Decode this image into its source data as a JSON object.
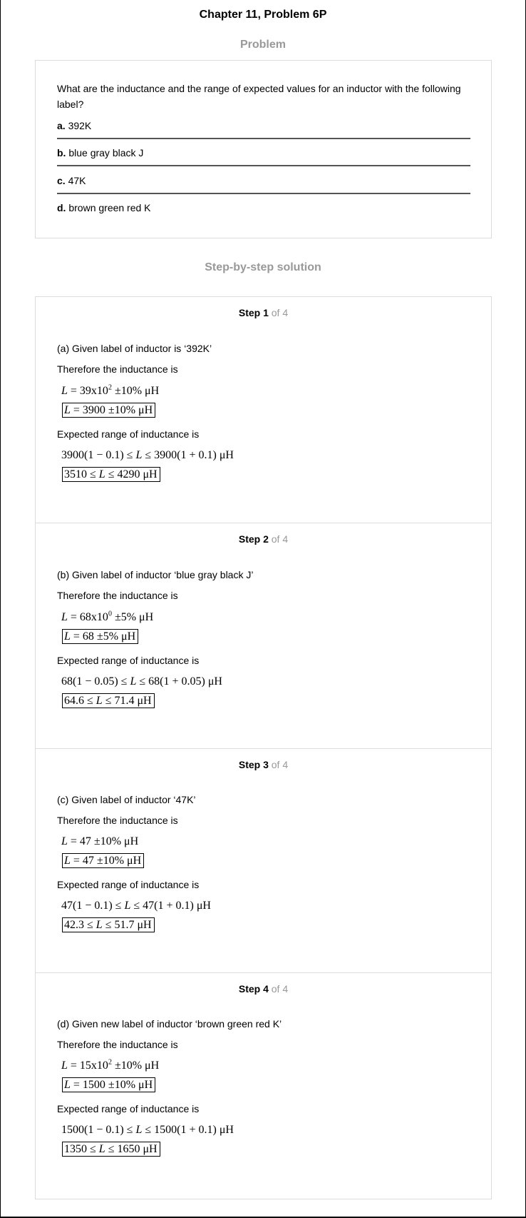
{
  "page": {
    "title": "Chapter 11, Problem 6P",
    "problem_heading": "Problem",
    "solution_heading": "Step-by-step solution"
  },
  "problem": {
    "question": "What are the inductance and the range of expected values for an inductor with the following label?",
    "parts": [
      {
        "letter": "a.",
        "text": "392K"
      },
      {
        "letter": "b.",
        "text": "blue gray black J"
      },
      {
        "letter": "c.",
        "text": "47K"
      },
      {
        "letter": "d.",
        "text": "brown green red K"
      }
    ]
  },
  "steps": [
    {
      "label": "Step 1",
      "of": "of 4",
      "given": "(a) Given label of inductor is ‘392K’",
      "therefore": "Therefore the inductance is",
      "expected": "Expected range of inductance is",
      "eq1": {
        "lhs": "L",
        "rhs_pre": " = 39x10",
        "exp": "2",
        "rhs_post": " ±10% μH"
      },
      "eq2": {
        "lhs": "L",
        "rhs": " = 3900 ±10% μH"
      },
      "range1": {
        "pre": "3900(1 − 0.1) ≤ ",
        "var": "L",
        "post": " ≤ 3900(1 + 0.1) μH"
      },
      "range2": {
        "pre": "3510 ≤ ",
        "var": "L",
        "post": " ≤ 4290 μH"
      }
    },
    {
      "label": "Step 2",
      "of": "of 4",
      "given": "(b) Given label of inductor ‘blue gray black J’",
      "therefore": "Therefore the inductance is",
      "expected": "Expected range of inductance is",
      "eq1": {
        "lhs": "L",
        "rhs_pre": " = 68x10",
        "exp": "0",
        "rhs_post": " ±5% μH"
      },
      "eq2": {
        "lhs": "L",
        "rhs": " = 68 ±5% μH"
      },
      "range1": {
        "pre": "68(1 − 0.05) ≤ ",
        "var": "L",
        "post": " ≤ 68(1 + 0.05) μH"
      },
      "range2": {
        "pre": "64.6 ≤ ",
        "var": "L",
        "post": " ≤ 71.4 μH"
      }
    },
    {
      "label": "Step 3",
      "of": "of 4",
      "given": "(c) Given label of inductor ‘47K’",
      "therefore": "Therefore the inductance is",
      "expected": "Expected range of inductance is",
      "eq1": {
        "lhs": "L",
        "rhs_pre": " = 47 ±10% μH",
        "exp": "",
        "rhs_post": ""
      },
      "eq2": {
        "lhs": "L",
        "rhs": " = 47 ±10% μH"
      },
      "range1": {
        "pre": "47(1 − 0.1) ≤ ",
        "var": "L",
        "post": " ≤ 47(1 + 0.1) μH"
      },
      "range2": {
        "pre": "42.3 ≤ ",
        "var": "L",
        "post": " ≤ 51.7 μH"
      }
    },
    {
      "label": "Step 4",
      "of": "of 4",
      "given": "(d) Given new label of inductor ‘brown green red K’",
      "therefore": "Therefore the inductance is",
      "expected": "Expected range of inductance is",
      "eq1": {
        "lhs": "L",
        "rhs_pre": " = 15x10",
        "exp": "2",
        "rhs_post": " ±10% μH"
      },
      "eq2": {
        "lhs": "L",
        "rhs": " = 1500 ±10% μH"
      },
      "range1": {
        "pre": "1500(1 − 0.1) ≤ ",
        "var": "L",
        "post": " ≤ 1500(1 + 0.1) μH"
      },
      "range2": {
        "pre": "1350 ≤ ",
        "var": "L",
        "post": " ≤ 1650 μH"
      }
    }
  ]
}
